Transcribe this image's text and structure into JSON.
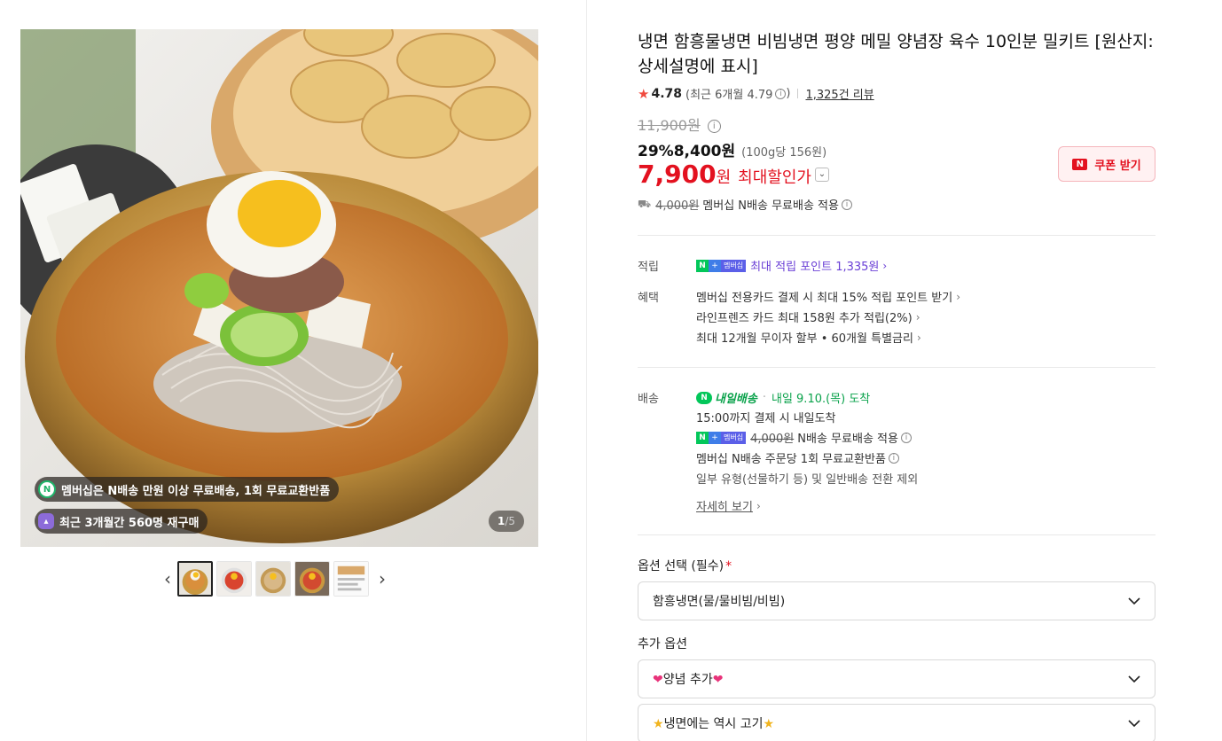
{
  "gallery": {
    "badge_membership": "멤버십은 N배송 만원 이상 무료배송, 1회 무료교환반품",
    "badge_membership_icon": "N",
    "badge_repurchase": "최근 3개월간 560명 재구매",
    "page_current": "1",
    "page_total": "/5",
    "thumb_count": 5,
    "prev_arrow": "‹",
    "next_arrow": "›"
  },
  "product": {
    "title": "냉면 함흥물냉면 비빔냉면 평양 메밀 양념장 육수 10인분 밀키트 [원산지:상세설명에 표시]",
    "rating": "4.78",
    "rating_recent": "(최근 6개월 4.79",
    "rating_recent_close": ")",
    "reviews": "1,325건 리뷰",
    "original_price": "11,900원",
    "discount_rate": "29%",
    "sale_price": "8,400원",
    "unit_price": "(100g당 156원)",
    "max_discount_price": "7,900",
    "max_discount_won": "원",
    "max_discount_label": "최대할인가",
    "coupon_button": "쿠폰 받기",
    "coupon_icon": "N",
    "shipping_original": "4,000원",
    "shipping_text": "멤버십 N배송 무료배송 적용"
  },
  "benefits": {
    "points_label": "적립",
    "points_text": "최대 적립 포인트 1,335원",
    "benefit_label": "혜택",
    "lines": [
      "멤버십 전용카드 결제 시 최대 15% 적립 포인트 받기",
      "라인프렌즈 카드 최대 158원 추가 적립(2%)",
      "최대 12개월 무이자 할부 • 60개월 특별금리"
    ]
  },
  "delivery": {
    "label": "배송",
    "tomorrow_badge": "내일배송",
    "arrival": "내일 9.10.(목) 도착",
    "cutoff": "15:00까지 결제 시 내일도착",
    "fee_original": "4,000원",
    "fee_text": "N배송 무료배송 적용",
    "exchange": "멤버십 N배송 주문당 1회 무료교환반품",
    "exception": "일부 유형(선물하기 등) 및 일반배송 전환 제외",
    "detail_link": "자세히 보기"
  },
  "badges": {
    "n": "N",
    "plus": "+",
    "membership": "멤버십"
  },
  "options": {
    "required_label": "옵션 선택 (필수)",
    "required_mark": "*",
    "required_value": "함흥냉면(물/물비빔/비빔)",
    "extra_label": "추가 옵션",
    "extra1": "양념 추가",
    "extra2": "냉면에는 역시 고기"
  },
  "colors": {
    "accent_red": "#e3111f",
    "naver_green": "#03c75a",
    "membership_purple": "#6a3fd6"
  }
}
